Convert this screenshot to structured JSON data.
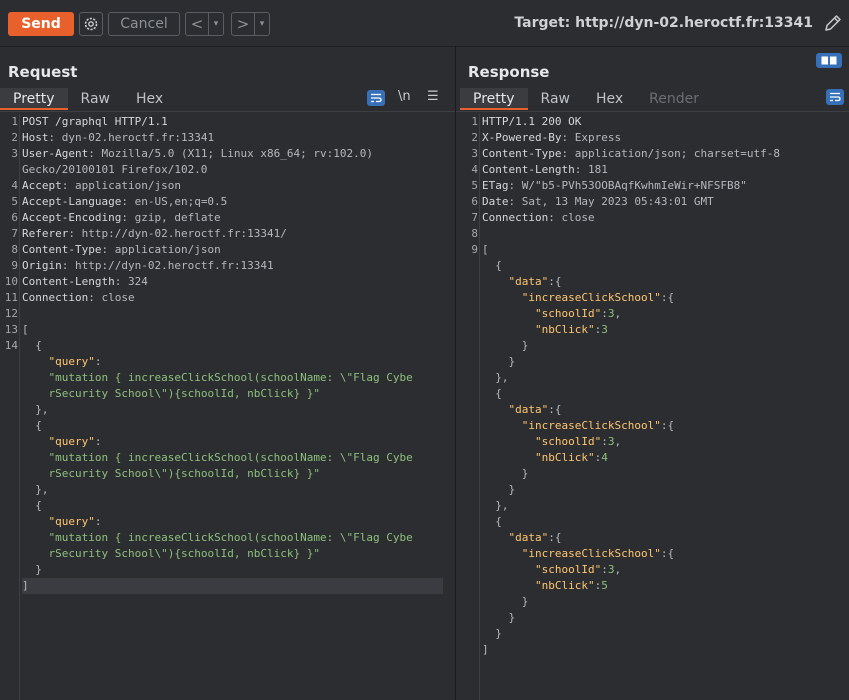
{
  "toolbar": {
    "send_label": "Send",
    "cancel_label": "Cancel",
    "back_arrow": "<",
    "forward_arrow": ">",
    "dropdown_glyph": "▾",
    "target_label": "Target: http://dyn-02.heroctf.fr:13341"
  },
  "request": {
    "title": "Request",
    "tabs": [
      "Pretty",
      "Raw",
      "Hex"
    ],
    "newline_toggle": "\\n",
    "menu_glyph": "☰",
    "line_numbers": [
      "1",
      "2",
      "3",
      "",
      "4",
      "5",
      "6",
      "7",
      "8",
      "9",
      "10",
      "11",
      "12",
      "13",
      "14"
    ],
    "header_lines": [
      {
        "key": "POST /graphql HTTP/1.1",
        "value": ""
      },
      {
        "key": "Host",
        "value": ": dyn-02.heroctf.fr:13341"
      },
      {
        "key": "User-Agent",
        "value": ": Mozilla/5.0 (X11; Linux x86_64; rv:102.0)"
      },
      {
        "key": "",
        "value": "Gecko/20100101 Firefox/102.0"
      },
      {
        "key": "Accept",
        "value": ": application/json"
      },
      {
        "key": "Accept-Language",
        "value": ": en-US,en;q=0.5"
      },
      {
        "key": "Accept-Encoding",
        "value": ": gzip, deflate"
      },
      {
        "key": "Referer",
        "value": ": http://dyn-02.heroctf.fr:13341/"
      },
      {
        "key": "Content-Type",
        "value": ": application/json"
      },
      {
        "key": "Origin",
        "value": ": http://dyn-02.heroctf.fr:13341"
      },
      {
        "key": "Content-Length",
        "value": ": 324"
      },
      {
        "key": "Connection",
        "value": ": close"
      }
    ],
    "body": {
      "open_bracket": "[",
      "close_bracket": "]",
      "open_brace": "{",
      "close_brace": "},",
      "last_close_brace": "}",
      "query_key": "\"query\"",
      "colon": ":",
      "query_line1": "\"mutation { increaseClickSchool(schoolName: \\\"Flag Cybe",
      "query_line2": "rSecurity School\\\"){schoolId, nbClick} }\""
    }
  },
  "response": {
    "title": "Response",
    "tabs": [
      "Pretty",
      "Raw",
      "Hex",
      "Render"
    ],
    "line_numbers": [
      "1",
      "2",
      "3",
      "4",
      "5",
      "6",
      "7",
      "8",
      "9"
    ],
    "header_lines": [
      {
        "key": "HTTP/1.1 200 OK",
        "value": ""
      },
      {
        "key": "X-Powered-By",
        "value": ": Express"
      },
      {
        "key": "Content-Type",
        "value": ": application/json; charset=utf-8"
      },
      {
        "key": "Content-Length",
        "value": ": 181"
      },
      {
        "key": "ETag",
        "value": ": W/\"b5-PVh53OOBAqfKwhmIeWir+NFSFB8\""
      },
      {
        "key": "Date",
        "value": ": Sat, 13 May 2023 05:43:01 GMT"
      },
      {
        "key": "Connection",
        "value": ": close"
      }
    ],
    "body": {
      "data_key": "\"data\"",
      "mutation_key": "\"increaseClickSchool\"",
      "school_key": "\"schoolId\"",
      "click_key": "\"nbClick\"",
      "items": [
        {
          "schoolId": "3",
          "nbClick": "3"
        },
        {
          "schoolId": "3",
          "nbClick": "4"
        },
        {
          "schoolId": "3",
          "nbClick": "5"
        }
      ]
    }
  },
  "colors": {
    "accent": "#e8612c",
    "toggle": "#3570b8"
  }
}
